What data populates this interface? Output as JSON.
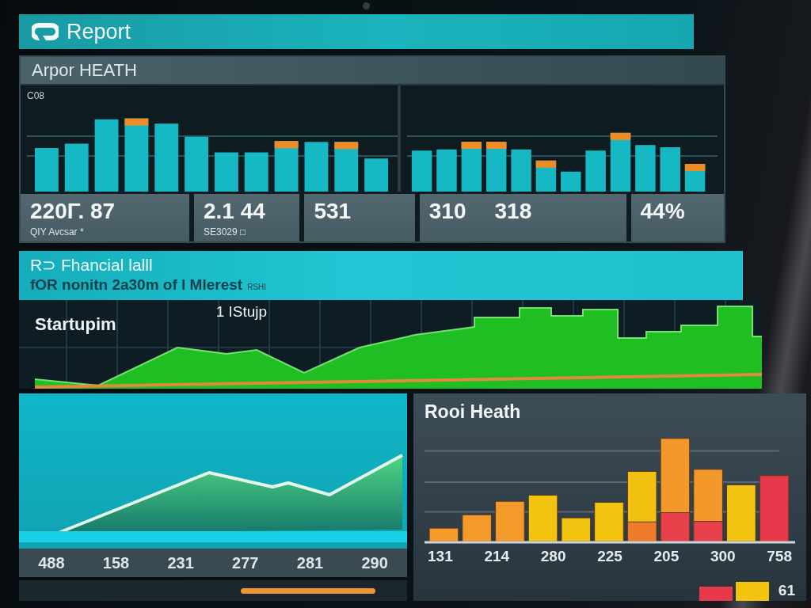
{
  "header": {
    "title": "Report"
  },
  "overview": {
    "title": "Arpor HEATH",
    "axis_label": "C08",
    "cards": [
      {
        "values": [
          "220Γ. 87"
        ],
        "caption": "QIY Avcsar *"
      },
      {
        "values": [
          "2.1 44"
        ],
        "caption": "SE3029 □"
      },
      {
        "values": [
          "531"
        ]
      },
      {
        "values": [
          "310",
          "318"
        ]
      },
      {
        "values": [
          "44%"
        ]
      }
    ]
  },
  "banner": {
    "title": "R⊃ Fhancial lalll",
    "subtitle": "fOR nonitn 2a30m of l Mlerest",
    "tag": "RSHI"
  },
  "growth": {
    "labels": [
      "Startupim",
      "1 IStujp"
    ]
  },
  "trend_card": {
    "axis_labels": [
      "488",
      "158",
      "231",
      "277",
      "281",
      "290"
    ]
  },
  "health_card": {
    "title": "Rooi Heath",
    "axis_labels": [
      "131",
      "214",
      "280",
      "225",
      "205",
      "300",
      "758"
    ],
    "footer_label": "61"
  }
}
